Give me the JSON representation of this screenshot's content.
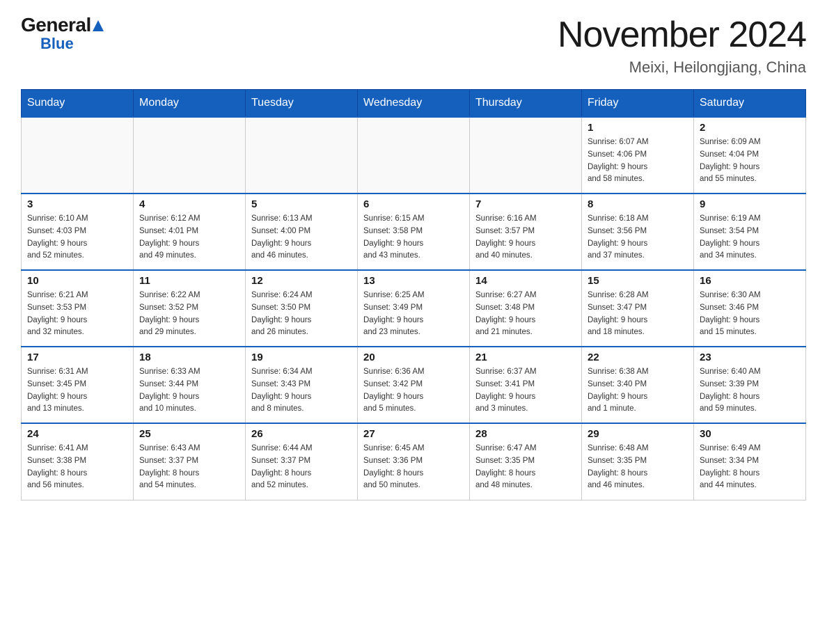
{
  "header": {
    "logo_general": "General",
    "logo_blue": "Blue",
    "title": "November 2024",
    "subtitle": "Meixi, Heilongjiang, China"
  },
  "days_of_week": [
    "Sunday",
    "Monday",
    "Tuesday",
    "Wednesday",
    "Thursday",
    "Friday",
    "Saturday"
  ],
  "weeks": [
    [
      {
        "day": "",
        "info": ""
      },
      {
        "day": "",
        "info": ""
      },
      {
        "day": "",
        "info": ""
      },
      {
        "day": "",
        "info": ""
      },
      {
        "day": "",
        "info": ""
      },
      {
        "day": "1",
        "info": "Sunrise: 6:07 AM\nSunset: 4:06 PM\nDaylight: 9 hours\nand 58 minutes."
      },
      {
        "day": "2",
        "info": "Sunrise: 6:09 AM\nSunset: 4:04 PM\nDaylight: 9 hours\nand 55 minutes."
      }
    ],
    [
      {
        "day": "3",
        "info": "Sunrise: 6:10 AM\nSunset: 4:03 PM\nDaylight: 9 hours\nand 52 minutes."
      },
      {
        "day": "4",
        "info": "Sunrise: 6:12 AM\nSunset: 4:01 PM\nDaylight: 9 hours\nand 49 minutes."
      },
      {
        "day": "5",
        "info": "Sunrise: 6:13 AM\nSunset: 4:00 PM\nDaylight: 9 hours\nand 46 minutes."
      },
      {
        "day": "6",
        "info": "Sunrise: 6:15 AM\nSunset: 3:58 PM\nDaylight: 9 hours\nand 43 minutes."
      },
      {
        "day": "7",
        "info": "Sunrise: 6:16 AM\nSunset: 3:57 PM\nDaylight: 9 hours\nand 40 minutes."
      },
      {
        "day": "8",
        "info": "Sunrise: 6:18 AM\nSunset: 3:56 PM\nDaylight: 9 hours\nand 37 minutes."
      },
      {
        "day": "9",
        "info": "Sunrise: 6:19 AM\nSunset: 3:54 PM\nDaylight: 9 hours\nand 34 minutes."
      }
    ],
    [
      {
        "day": "10",
        "info": "Sunrise: 6:21 AM\nSunset: 3:53 PM\nDaylight: 9 hours\nand 32 minutes."
      },
      {
        "day": "11",
        "info": "Sunrise: 6:22 AM\nSunset: 3:52 PM\nDaylight: 9 hours\nand 29 minutes."
      },
      {
        "day": "12",
        "info": "Sunrise: 6:24 AM\nSunset: 3:50 PM\nDaylight: 9 hours\nand 26 minutes."
      },
      {
        "day": "13",
        "info": "Sunrise: 6:25 AM\nSunset: 3:49 PM\nDaylight: 9 hours\nand 23 minutes."
      },
      {
        "day": "14",
        "info": "Sunrise: 6:27 AM\nSunset: 3:48 PM\nDaylight: 9 hours\nand 21 minutes."
      },
      {
        "day": "15",
        "info": "Sunrise: 6:28 AM\nSunset: 3:47 PM\nDaylight: 9 hours\nand 18 minutes."
      },
      {
        "day": "16",
        "info": "Sunrise: 6:30 AM\nSunset: 3:46 PM\nDaylight: 9 hours\nand 15 minutes."
      }
    ],
    [
      {
        "day": "17",
        "info": "Sunrise: 6:31 AM\nSunset: 3:45 PM\nDaylight: 9 hours\nand 13 minutes."
      },
      {
        "day": "18",
        "info": "Sunrise: 6:33 AM\nSunset: 3:44 PM\nDaylight: 9 hours\nand 10 minutes."
      },
      {
        "day": "19",
        "info": "Sunrise: 6:34 AM\nSunset: 3:43 PM\nDaylight: 9 hours\nand 8 minutes."
      },
      {
        "day": "20",
        "info": "Sunrise: 6:36 AM\nSunset: 3:42 PM\nDaylight: 9 hours\nand 5 minutes."
      },
      {
        "day": "21",
        "info": "Sunrise: 6:37 AM\nSunset: 3:41 PM\nDaylight: 9 hours\nand 3 minutes."
      },
      {
        "day": "22",
        "info": "Sunrise: 6:38 AM\nSunset: 3:40 PM\nDaylight: 9 hours\nand 1 minute."
      },
      {
        "day": "23",
        "info": "Sunrise: 6:40 AM\nSunset: 3:39 PM\nDaylight: 8 hours\nand 59 minutes."
      }
    ],
    [
      {
        "day": "24",
        "info": "Sunrise: 6:41 AM\nSunset: 3:38 PM\nDaylight: 8 hours\nand 56 minutes."
      },
      {
        "day": "25",
        "info": "Sunrise: 6:43 AM\nSunset: 3:37 PM\nDaylight: 8 hours\nand 54 minutes."
      },
      {
        "day": "26",
        "info": "Sunrise: 6:44 AM\nSunset: 3:37 PM\nDaylight: 8 hours\nand 52 minutes."
      },
      {
        "day": "27",
        "info": "Sunrise: 6:45 AM\nSunset: 3:36 PM\nDaylight: 8 hours\nand 50 minutes."
      },
      {
        "day": "28",
        "info": "Sunrise: 6:47 AM\nSunset: 3:35 PM\nDaylight: 8 hours\nand 48 minutes."
      },
      {
        "day": "29",
        "info": "Sunrise: 6:48 AM\nSunset: 3:35 PM\nDaylight: 8 hours\nand 46 minutes."
      },
      {
        "day": "30",
        "info": "Sunrise: 6:49 AM\nSunset: 3:34 PM\nDaylight: 8 hours\nand 44 minutes."
      }
    ]
  ]
}
